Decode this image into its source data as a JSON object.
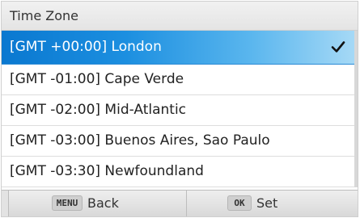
{
  "header": {
    "title": "Time Zone"
  },
  "timezones": [
    {
      "label": "[GMT +00:00] London",
      "selected": true
    },
    {
      "label": "[GMT -01:00] Cape Verde",
      "selected": false
    },
    {
      "label": "[GMT -02:00] Mid-Atlantic",
      "selected": false
    },
    {
      "label": "[GMT -03:00] Buenos Aires, Sao Paulo",
      "selected": false
    },
    {
      "label": "[GMT -03:30] Newfoundland",
      "selected": false
    }
  ],
  "selected_indicator_icon": "checkmark-icon",
  "footer": {
    "back": {
      "key": "MENU",
      "label": "Back"
    },
    "set": {
      "key": "OK",
      "label": "Set"
    }
  },
  "colors": {
    "selection_start": "#0a78d0",
    "selection_end": "#a8daf6",
    "background": "#ffffff"
  }
}
